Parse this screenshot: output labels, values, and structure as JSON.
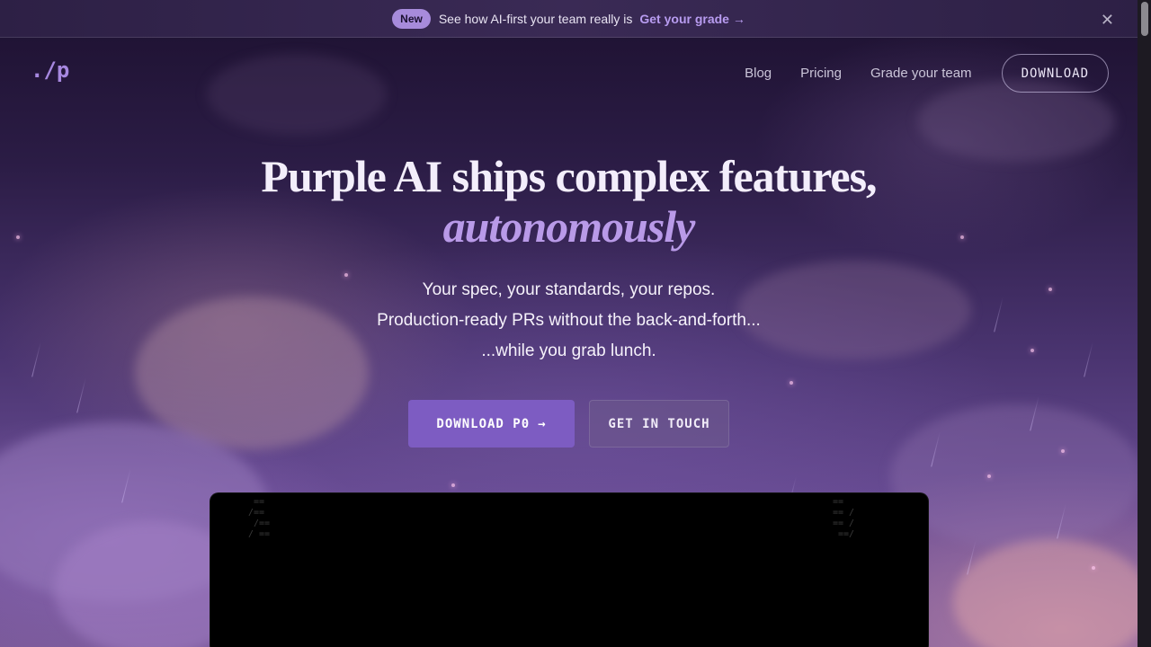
{
  "announcement": {
    "badge": "New",
    "text": "See how AI-first your team really is",
    "link": "Get your grade →",
    "close_icon": "close-icon"
  },
  "nav": {
    "logo": "./p",
    "links": [
      "Blog",
      "Pricing",
      "Grade your team"
    ],
    "download": "DOWNLOAD"
  },
  "hero": {
    "headline": "Purple AI ships complex features,",
    "headline_accent": "autonomously",
    "sub_lines": [
      "Your spec, your standards, your repos.",
      "Production-ready PRs without the back-and-forth...",
      "...while you grab lunch."
    ],
    "primary_cta": "DOWNLOAD P0",
    "primary_arrow": "→",
    "secondary_cta": "GET IN TOUCH"
  },
  "colors": {
    "accent": "#7d5cc2",
    "accent_text": "#b99ae8",
    "background": "#2b1c45"
  }
}
